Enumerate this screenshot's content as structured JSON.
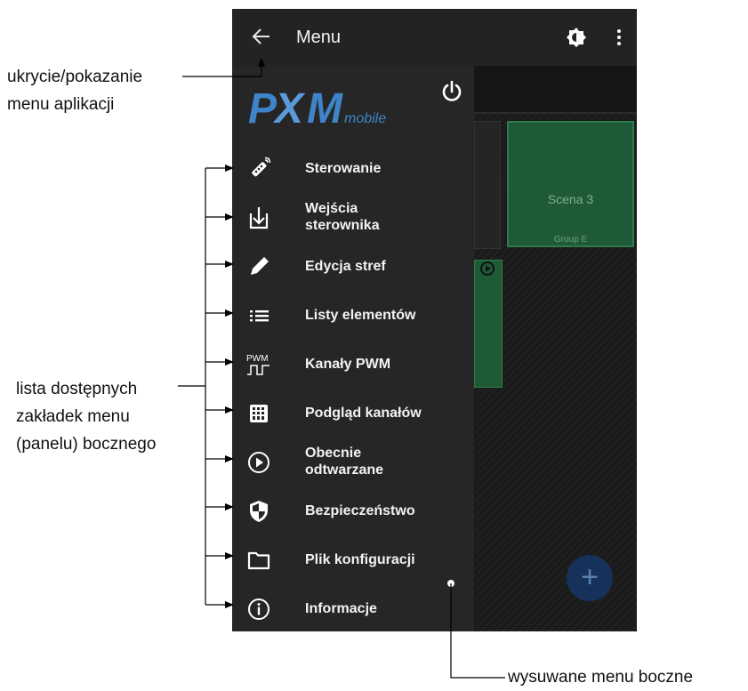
{
  "appbar": {
    "title": "Menu"
  },
  "background": {
    "scene_name": "Scena 3",
    "scene_group": "Group E"
  },
  "drawer": {
    "logo_text": "PXMmobile",
    "items": [
      {
        "label": "Sterowanie",
        "icon": "remote-icon"
      },
      {
        "label": "Wejścia\nsterownika",
        "icon": "download-box-icon"
      },
      {
        "label": "Edycja stref",
        "icon": "pencil-icon"
      },
      {
        "label": "Listy elementów",
        "icon": "list-icon"
      },
      {
        "label": "Kanały PWM",
        "icon": "pwm-icon",
        "icon_text": "PWM"
      },
      {
        "label": "Podgląd kanałów",
        "icon": "grid-icon"
      },
      {
        "label": "Obecnie\nodtwarzane",
        "icon": "play-circle-icon"
      },
      {
        "label": "Bezpieczeństwo",
        "icon": "shield-icon"
      },
      {
        "label": "Plik konfiguracji",
        "icon": "folder-icon"
      },
      {
        "label": "Informacje",
        "icon": "info-icon"
      }
    ]
  },
  "annotations": {
    "toggle": "ukrycie/pokazanie\nmenu aplikacji",
    "tabs": "lista dostępnych\nzakładek menu\n(panelu) bocznego",
    "drawer": "wysuwane menu boczne"
  }
}
